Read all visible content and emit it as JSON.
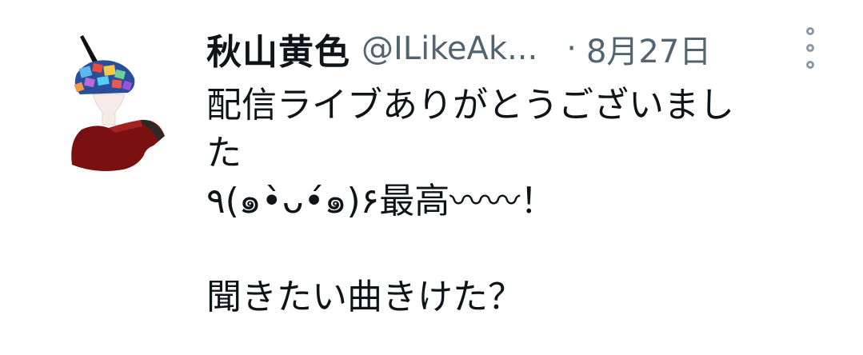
{
  "tweet": {
    "display_name": "秋山黄色",
    "handle": "@ILikeAk...",
    "separator": "·",
    "date": "8月27日",
    "more_icon": "vertical-ellipsis-icon",
    "avatar_icon": "user-avatar-illustration",
    "text_lines": [
      "配信ライブありがとうございまし",
      "た",
      "٩(๑•̀ᴗ•́๑)۶最高〰〰！",
      "",
      "聞きたい曲きけた？"
    ]
  }
}
